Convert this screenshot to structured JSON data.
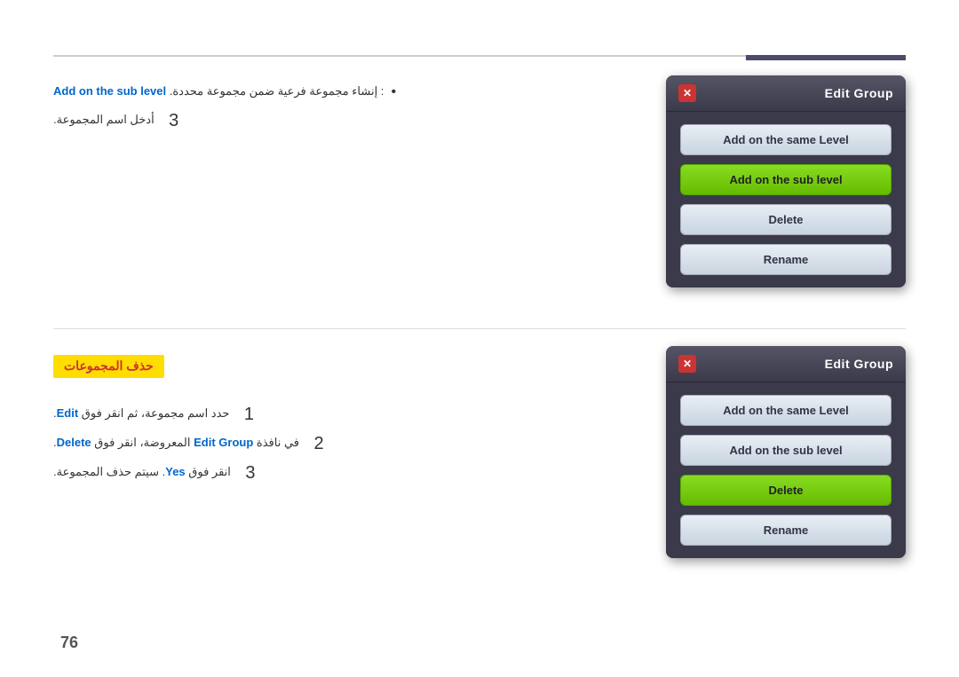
{
  "page": {
    "number": "76"
  },
  "top_section": {
    "bullet": {
      "text_before": ": إنشاء مجموعة فرعية ضمن مجموعة محددة.",
      "highlight": "Add on the sub level",
      "bullet_char": "•"
    },
    "step3": {
      "number": "3",
      "text": "أدخل اسم المجموعة."
    }
  },
  "bottom_section": {
    "heading": "حذف المجموعات",
    "step1": {
      "number": "1",
      "text_before": "حدد اسم مجموعة، ثم انقر فوق",
      "highlight": "Edit",
      "text_after": "."
    },
    "step2": {
      "number": "2",
      "text_before": "في نافذة",
      "highlight1": "Edit Group",
      "text_middle": "المعروضة، انقر فوق",
      "highlight2": "Delete",
      "text_after": "."
    },
    "step3": {
      "number": "3",
      "text_before": "انقر فوق",
      "highlight": "Yes",
      "text_after": ". سيتم حذف المجموعة."
    }
  },
  "panel_top": {
    "title": "Edit Group",
    "buttons": [
      {
        "label": "Add on the same Level",
        "type": "light"
      },
      {
        "label": "Add on the sub level",
        "type": "green"
      },
      {
        "label": "Delete",
        "type": "light"
      },
      {
        "label": "Rename",
        "type": "light"
      }
    ]
  },
  "panel_bottom": {
    "title": "Edit Group",
    "buttons": [
      {
        "label": "Add on the same Level",
        "type": "light"
      },
      {
        "label": "Add on the sub level",
        "type": "light"
      },
      {
        "label": "Delete",
        "type": "green"
      },
      {
        "label": "Rename",
        "type": "light"
      }
    ]
  }
}
